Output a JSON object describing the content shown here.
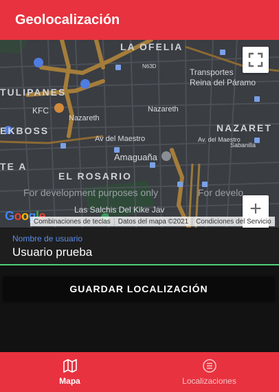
{
  "appbar": {
    "title": "Geolocalización"
  },
  "map": {
    "labels": {
      "la_ofelia": "LA OFELIA",
      "tulipanes": "TULIPANES",
      "kekboss": "EKBOSS",
      "nazaret_district": "NAZARET",
      "el_rosario": "EL ROSARIO",
      "te_a": "TE A",
      "kfc": "KFC",
      "transportes": "Transportes",
      "reina": "Reina del Páramo",
      "n63d": "N63D",
      "nazareth_street": "Nazareth",
      "nazareth_street2": "Nazareth",
      "av_maestro": "Av del Maestro",
      "av_maestro2": "Av. del Maestro",
      "sabanilla": "Sabanilla",
      "amaguana": "Amaguaña",
      "las_salchis": "Las Salchis Del Kike Jav",
      "dev1": "For development purposes only",
      "dev2": "For develo"
    },
    "google_logo": "Google",
    "attribution": {
      "shortcuts": "Combinaciones de teclas",
      "map_data": "Datos del mapa ©2021",
      "terms": "Condiciones del Servicio"
    },
    "controls": {
      "fullscreen": "⛶",
      "zoom_in": "+",
      "zoom_out": "−"
    }
  },
  "form": {
    "username_label": "Nombre de usuario",
    "username_value": "Usuario prueba",
    "save_label": "GUARDAR LOCALIZACIÓN"
  },
  "nav": [
    {
      "label": "Mapa",
      "icon": "map-icon",
      "active": true
    },
    {
      "label": "Localizaciones",
      "icon": "list-icon",
      "active": false
    }
  ],
  "colors": {
    "primary": "#e8323f",
    "field_label": "#5b8de8",
    "underline": "#4fd07a",
    "background": "#121212"
  }
}
